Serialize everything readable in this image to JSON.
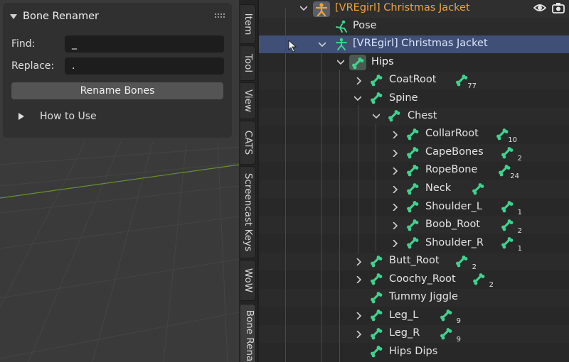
{
  "panel": {
    "title": "Bone Renamer",
    "find_label": "Find:",
    "find_value": "_",
    "replace_label": "Replace:",
    "replace_value": ".",
    "rename_button": "Rename Bones",
    "how_to_use": "How to Use"
  },
  "tabs": [
    "Item",
    "Tool",
    "View",
    "CATS",
    "Screencast Keys",
    "WoW",
    "Bone Rena"
  ],
  "outliner": {
    "armature_object": "[VREgirl] Christmas Jacket",
    "pose": "Pose",
    "armature_data": "[VREgirl] Christmas Jacket",
    "bones": {
      "hips": "Hips",
      "coatroot": "CoatRoot",
      "coatroot_count": "77",
      "spine": "Spine",
      "chest": "Chest",
      "collarroot": "CollarRoot",
      "collarroot_count": "10",
      "capebones": "CapeBones",
      "capebones_count": "2",
      "ropebone": "RopeBone",
      "ropebone_count": "24",
      "neck": "Neck",
      "shoulder_l": "Shoulder_L",
      "shoulder_l_count": "1",
      "boob_root": "Boob_Root",
      "boob_root_count": "2",
      "shoulder_r": "Shoulder_R",
      "shoulder_r_count": "1",
      "butt_root": "Butt_Root",
      "butt_root_count": "2",
      "coochy_root": "Coochy_Root",
      "coochy_root_count": "2",
      "tummy_jiggle": "Tummy Jiggle",
      "leg_l": "Leg_L",
      "leg_l_count": "9",
      "leg_r": "Leg_R",
      "leg_r_count": "9",
      "hips_dips": "Hips Dips"
    }
  },
  "colors": {
    "accent_orange": "#f3a33a",
    "bone_green": "#3fd38f",
    "selection_blue": "#3f4f76"
  },
  "icons": [
    "armature-object-icon",
    "pose-icon",
    "armature-data-icon",
    "bone-icon",
    "eye-icon",
    "camera-icon",
    "mouse-cursor-icon"
  ]
}
